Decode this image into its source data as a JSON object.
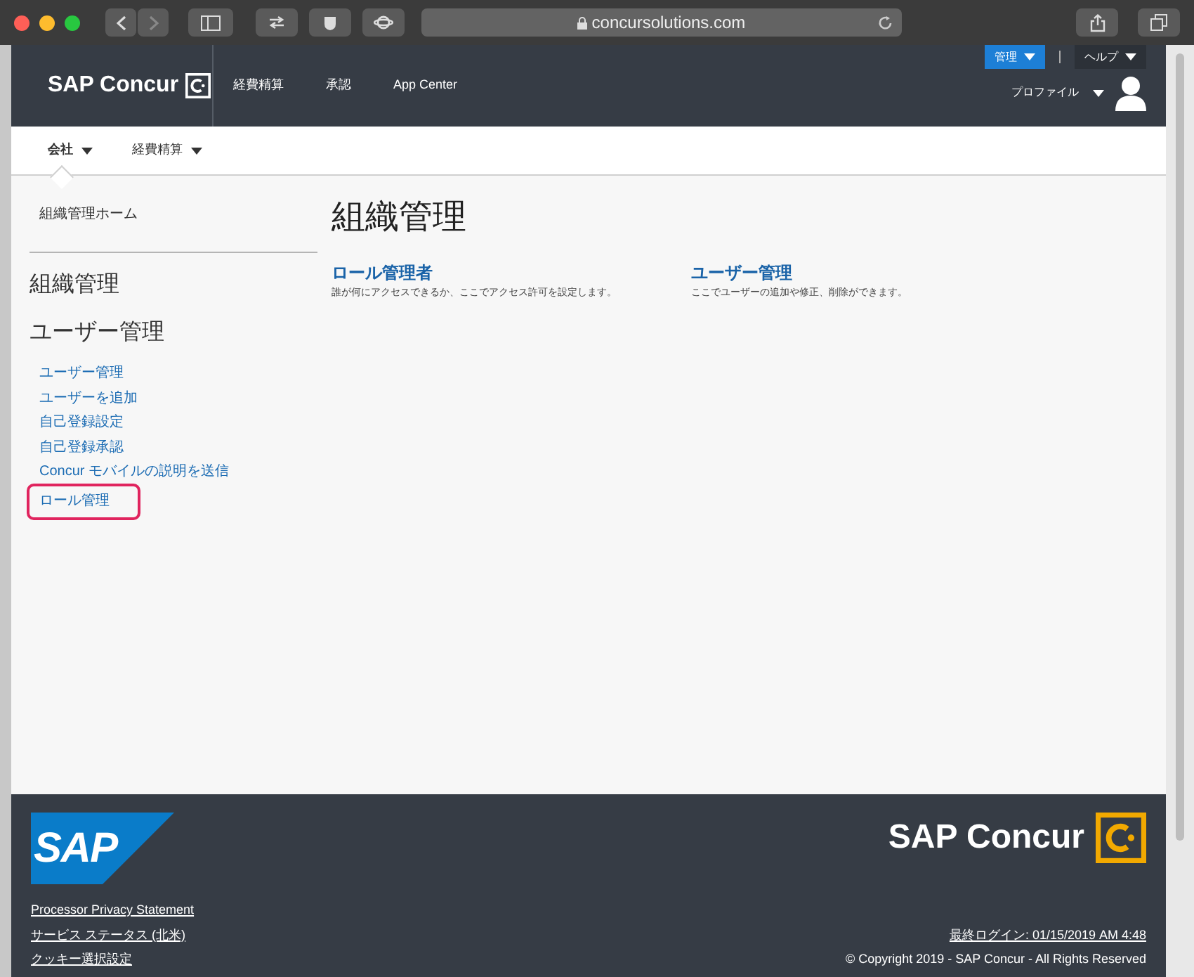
{
  "browser": {
    "url": "concursolutions.com"
  },
  "header": {
    "brand": "SAP Concur",
    "nav": [
      "経費精算",
      "承認",
      "App Center"
    ],
    "admin_button": "管理",
    "help": "ヘルプ",
    "profile": "プロファイル"
  },
  "subnav": [
    {
      "label": "会社",
      "selected": true
    },
    {
      "label": "経費精算",
      "selected": false
    }
  ],
  "sidebar": {
    "home": "組織管理ホーム",
    "sections": [
      {
        "title": "組織管理"
      },
      {
        "title": "ユーザー管理",
        "links": [
          {
            "label": "ユーザー管理",
            "selected": false
          },
          {
            "label": "ユーザーを追加",
            "selected": false
          },
          {
            "label": "自己登録設定",
            "selected": false
          },
          {
            "label": "自己登録承認",
            "selected": false
          },
          {
            "label": "Concur モバイルの説明を送信",
            "selected": false
          },
          {
            "label": "ロール管理",
            "selected": true
          }
        ]
      }
    ]
  },
  "main": {
    "title": "組織管理",
    "cards": [
      {
        "title": "ロール管理者",
        "description": "誰が何にアクセスできるか、ここでアクセス許可を設定します。"
      },
      {
        "title": "ユーザー管理",
        "description": "ここでユーザーの追加や修正、削除ができます。"
      }
    ]
  },
  "footer": {
    "sap_logo": "SAP",
    "brand": "SAP Concur",
    "links": [
      "Processor Privacy Statement",
      "サービス ステータス (北米)",
      "クッキー選択設定"
    ],
    "last_login": "最終ログイン: 01/15/2019 AM 4:48",
    "copyright": "© Copyright 2019 - SAP Concur - All Rights Reserved"
  }
}
